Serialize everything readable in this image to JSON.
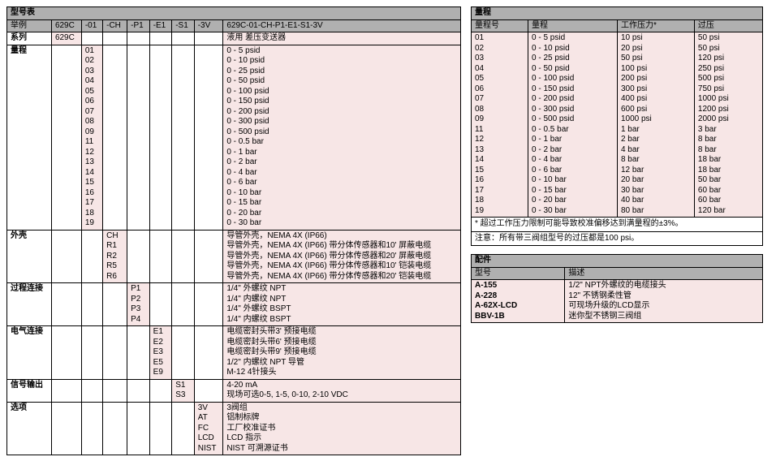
{
  "model_table": {
    "title": "型号表",
    "header_row": [
      "举例",
      "629C",
      "-01",
      "-CH",
      "-P1",
      "-E1",
      "-S1",
      "-3V",
      "629C-01-CH-P1-E1-S1-3V"
    ],
    "rows": [
      {
        "label": "系列",
        "cols": [
          "629C",
          "",
          "",
          "",
          "",
          "",
          ""
        ],
        "desc": "液用 差压变送器"
      },
      {
        "label": "量程",
        "codes": [
          "01",
          "02",
          "03",
          "04",
          "05",
          "06",
          "07",
          "08",
          "09",
          "11",
          "12",
          "13",
          "14",
          "15",
          "16",
          "17",
          "18",
          "19"
        ],
        "descs": [
          "0 - 5 psid",
          "0 - 10 psid",
          "0 - 25 psid",
          "0 - 50 psid",
          "0 - 100 psid",
          "0 - 150 psid",
          "0 - 200 psid",
          "0 - 300 psid",
          "0 - 500 psid",
          "0 - 0.5 bar",
          "0 - 1 bar",
          "0 - 2 bar",
          "0 - 4 bar",
          "0 - 6 bar",
          "0 - 10 bar",
          "0 - 15 bar",
          "0 - 20 bar",
          "0 - 30 bar"
        ]
      },
      {
        "label": "外壳",
        "codes": [
          "CH",
          "R1",
          "R2",
          "R5",
          "R6"
        ],
        "descs": [
          "导管外壳，NEMA 4X (IP66)",
          "导管外壳，NEMA 4X (IP66) 带分体传感器和10' 屏蔽电缆",
          "导管外壳，NEMA 4X (IP66) 带分体传感器和20' 屏蔽电缆",
          "导管外壳，NEMA 4X (IP66) 带分体传感器和10' 铠装电缆",
          "导管外壳，NEMA 4X (IP66) 带分体传感器和20' 铠装电缆"
        ]
      },
      {
        "label": "过程连接",
        "codes": [
          "P1",
          "P2",
          "P3",
          "P4"
        ],
        "descs": [
          "1/4\" 外螺纹 NPT",
          "1/4\" 内螺纹 NPT",
          "1/4\" 外螺纹 BSPT",
          "1/4\" 内螺纹 BSPT"
        ]
      },
      {
        "label": "电气连接",
        "codes": [
          "E1",
          "E2",
          "E3",
          "E5",
          "E9"
        ],
        "descs": [
          "电缆密封头带3' 预接电缆",
          "电缆密封头带6' 预接电缆",
          "电缆密封头带9' 预接电缆",
          "1/2\" 内螺纹 NPT 导管",
          "M-12 4针接头"
        ]
      },
      {
        "label": "信号输出",
        "codes": [
          "S1",
          "S3"
        ],
        "descs": [
          "4-20 mA",
          "现场可选0-5, 1-5, 0-10, 2-10 VDC"
        ]
      },
      {
        "label": "选项",
        "codes": [
          "3V",
          "AT",
          "FC",
          "LCD",
          "NIST"
        ],
        "descs": [
          "3阀组",
          "铝制标牌",
          "工厂校准证书",
          "LCD 指示",
          "NIST 可溯源证书"
        ]
      }
    ]
  },
  "range_table": {
    "title": "量程",
    "headers": [
      "量程号",
      "量程",
      "工作压力*",
      "过压"
    ],
    "rows": [
      [
        "01",
        "0 - 5 psid",
        "10 psi",
        "50 psi"
      ],
      [
        "02",
        "0 - 10 psid",
        "20 psi",
        "50 psi"
      ],
      [
        "03",
        "0 - 25 psid",
        "50 psi",
        "120 psi"
      ],
      [
        "04",
        "0 - 50 psid",
        "100 psi",
        "250 psi"
      ],
      [
        "05",
        "0 - 100 psid",
        "200 psi",
        "500 psi"
      ],
      [
        "06",
        "0 - 150 psid",
        "300 psi",
        "750 psi"
      ],
      [
        "07",
        "0 - 200 psid",
        "400 psi",
        "1000 psi"
      ],
      [
        "08",
        "0 - 300 psid",
        "600 psi",
        "1200 psi"
      ],
      [
        "09",
        "0 - 500 psid",
        "1000 psi",
        "2000 psi"
      ],
      [
        "11",
        "0 - 0.5 bar",
        "1 bar",
        "3 bar"
      ],
      [
        "12",
        "0 - 1 bar",
        "2 bar",
        "8 bar"
      ],
      [
        "13",
        "0 - 2 bar",
        "4 bar",
        "8 bar"
      ],
      [
        "14",
        "0 - 4 bar",
        "8 bar",
        "18 bar"
      ],
      [
        "15",
        "0 - 6 bar",
        "12 bar",
        "18 bar"
      ],
      [
        "16",
        "0 - 10 bar",
        "20 bar",
        "50 bar"
      ],
      [
        "17",
        "0 - 15 bar",
        "30 bar",
        "60 bar"
      ],
      [
        "18",
        "0 - 20 bar",
        "40 bar",
        "60 bar"
      ],
      [
        "19",
        "0 - 30 bar",
        "80 bar",
        "120 bar"
      ]
    ],
    "note1": "* 超过工作压力限制可能导致校准偏移达到满量程的±3%。",
    "note2": "注意：所有带三阀组型号的过压都是100 psi。"
  },
  "acc_table": {
    "title": "配件",
    "headers": [
      "型号",
      "描述"
    ],
    "rows": [
      [
        "A-155",
        "1/2\" NPT外螺纹的电缆接头"
      ],
      [
        "A-228",
        "12\" 不锈钢柔性管"
      ],
      [
        "A-62X-LCD",
        "可现场升级的LCD显示"
      ],
      [
        "BBV-1B",
        "迷你型不锈钢三阀组"
      ]
    ]
  }
}
